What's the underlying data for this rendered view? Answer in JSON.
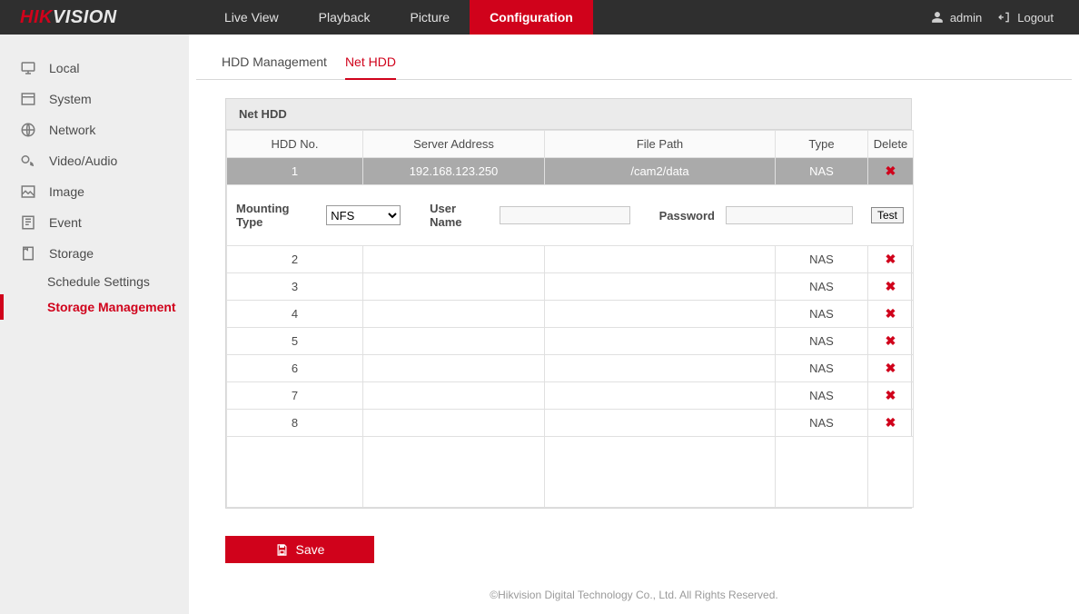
{
  "brand": {
    "hik": "HIK",
    "vision": "VISION"
  },
  "top_nav": {
    "live_view": "Live View",
    "playback": "Playback",
    "picture": "Picture",
    "configuration": "Configuration"
  },
  "top_right": {
    "user": "admin",
    "logout": "Logout"
  },
  "sidebar": {
    "local": "Local",
    "system": "System",
    "network": "Network",
    "video_audio": "Video/Audio",
    "image": "Image",
    "event": "Event",
    "storage": "Storage",
    "schedule_settings": "Schedule Settings",
    "storage_management": "Storage Management"
  },
  "tabs": {
    "hdd_management": "HDD Management",
    "net_hdd": "Net HDD"
  },
  "panel": {
    "title": "Net HDD",
    "columns": {
      "no": "HDD No.",
      "server": "Server Address",
      "path": "File Path",
      "type": "Type",
      "delete": "Delete"
    },
    "rows": [
      {
        "no": "1",
        "server": "192.168.123.250",
        "path": "/cam2/data",
        "type": "NAS",
        "selected": true
      },
      {
        "no": "2",
        "server": "",
        "path": "",
        "type": "NAS",
        "selected": false
      },
      {
        "no": "3",
        "server": "",
        "path": "",
        "type": "NAS",
        "selected": false
      },
      {
        "no": "4",
        "server": "",
        "path": "",
        "type": "NAS",
        "selected": false
      },
      {
        "no": "5",
        "server": "",
        "path": "",
        "type": "NAS",
        "selected": false
      },
      {
        "no": "6",
        "server": "",
        "path": "",
        "type": "NAS",
        "selected": false
      },
      {
        "no": "7",
        "server": "",
        "path": "",
        "type": "NAS",
        "selected": false
      },
      {
        "no": "8",
        "server": "",
        "path": "",
        "type": "NAS",
        "selected": false
      }
    ],
    "mounting": {
      "label": "Mounting Type",
      "value": "NFS",
      "username_label": "User Name",
      "username_value": "",
      "password_label": "Password",
      "password_value": "",
      "test": "Test"
    }
  },
  "save": "Save",
  "footer": "©Hikvision Digital Technology Co., Ltd. All Rights Reserved."
}
